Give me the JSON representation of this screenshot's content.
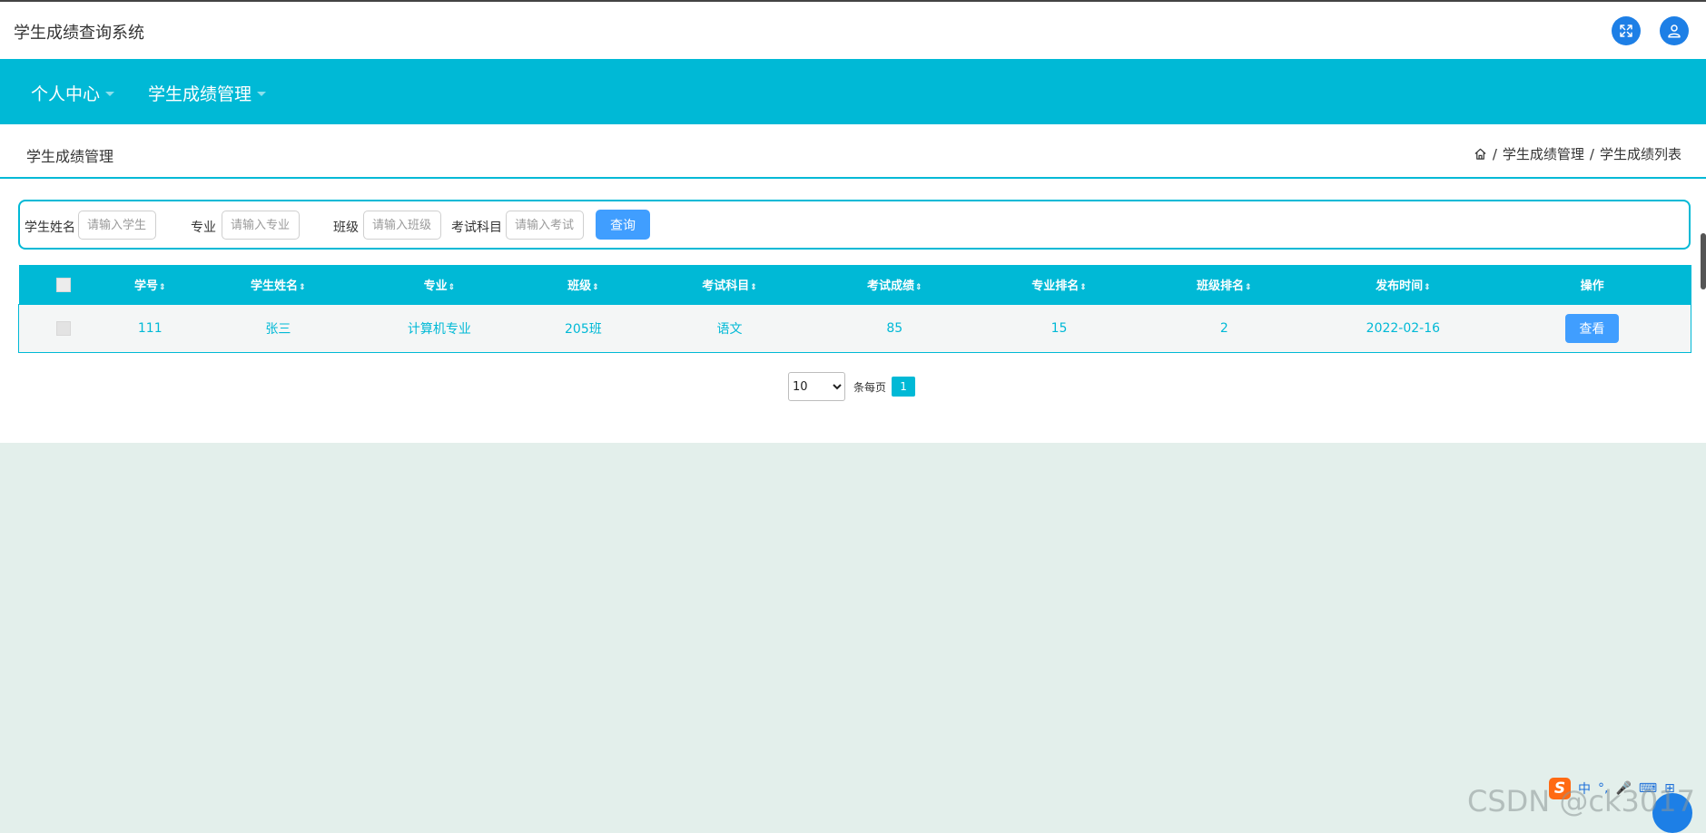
{
  "header": {
    "app_title": "学生成绩查询系统",
    "fullscreen_icon": "expand-arrows-icon",
    "user_icon": "user-icon"
  },
  "nav": {
    "items": [
      {
        "label": "个人中心"
      },
      {
        "label": "学生成绩管理"
      }
    ]
  },
  "page": {
    "title": "学生成绩管理",
    "breadcrumb": {
      "home_icon": "home-icon",
      "separator": "/",
      "items": [
        "学生成绩管理",
        "学生成绩列表"
      ]
    }
  },
  "search": {
    "fields": [
      {
        "label": "学生姓名",
        "placeholder": "请输入学生"
      },
      {
        "label": "专业",
        "placeholder": "请输入专业"
      },
      {
        "label": "班级",
        "placeholder": "请输入班级"
      },
      {
        "label": "考试科目",
        "placeholder": "请输入考试"
      }
    ],
    "query_label": "查询"
  },
  "table": {
    "sort_glyph": "⇕",
    "columns": [
      "学号",
      "学生姓名",
      "专业",
      "班级",
      "考试科目",
      "考试成绩",
      "专业排名",
      "班级排名",
      "发布时间",
      "操作"
    ],
    "rows": [
      {
        "student_id": "111",
        "name": "张三",
        "major": "计算机专业",
        "class": "205班",
        "subject": "语文",
        "score": "85",
        "major_rank": "15",
        "class_rank": "2",
        "publish_date": "2022-02-16",
        "action_label": "查看"
      }
    ]
  },
  "pagination": {
    "page_size": "10",
    "page_size_options": [
      "10"
    ],
    "per_page_label": "条每页",
    "current_page": "1"
  },
  "tray": {
    "ime_logo": "S",
    "ime_items": [
      "中",
      "°,",
      "🎤",
      "⌨",
      "⊞"
    ]
  },
  "watermark": "CSDN @ck3017",
  "colors": {
    "primary": "#00b9d6",
    "button": "#409eff",
    "background": "#e3efeb"
  }
}
